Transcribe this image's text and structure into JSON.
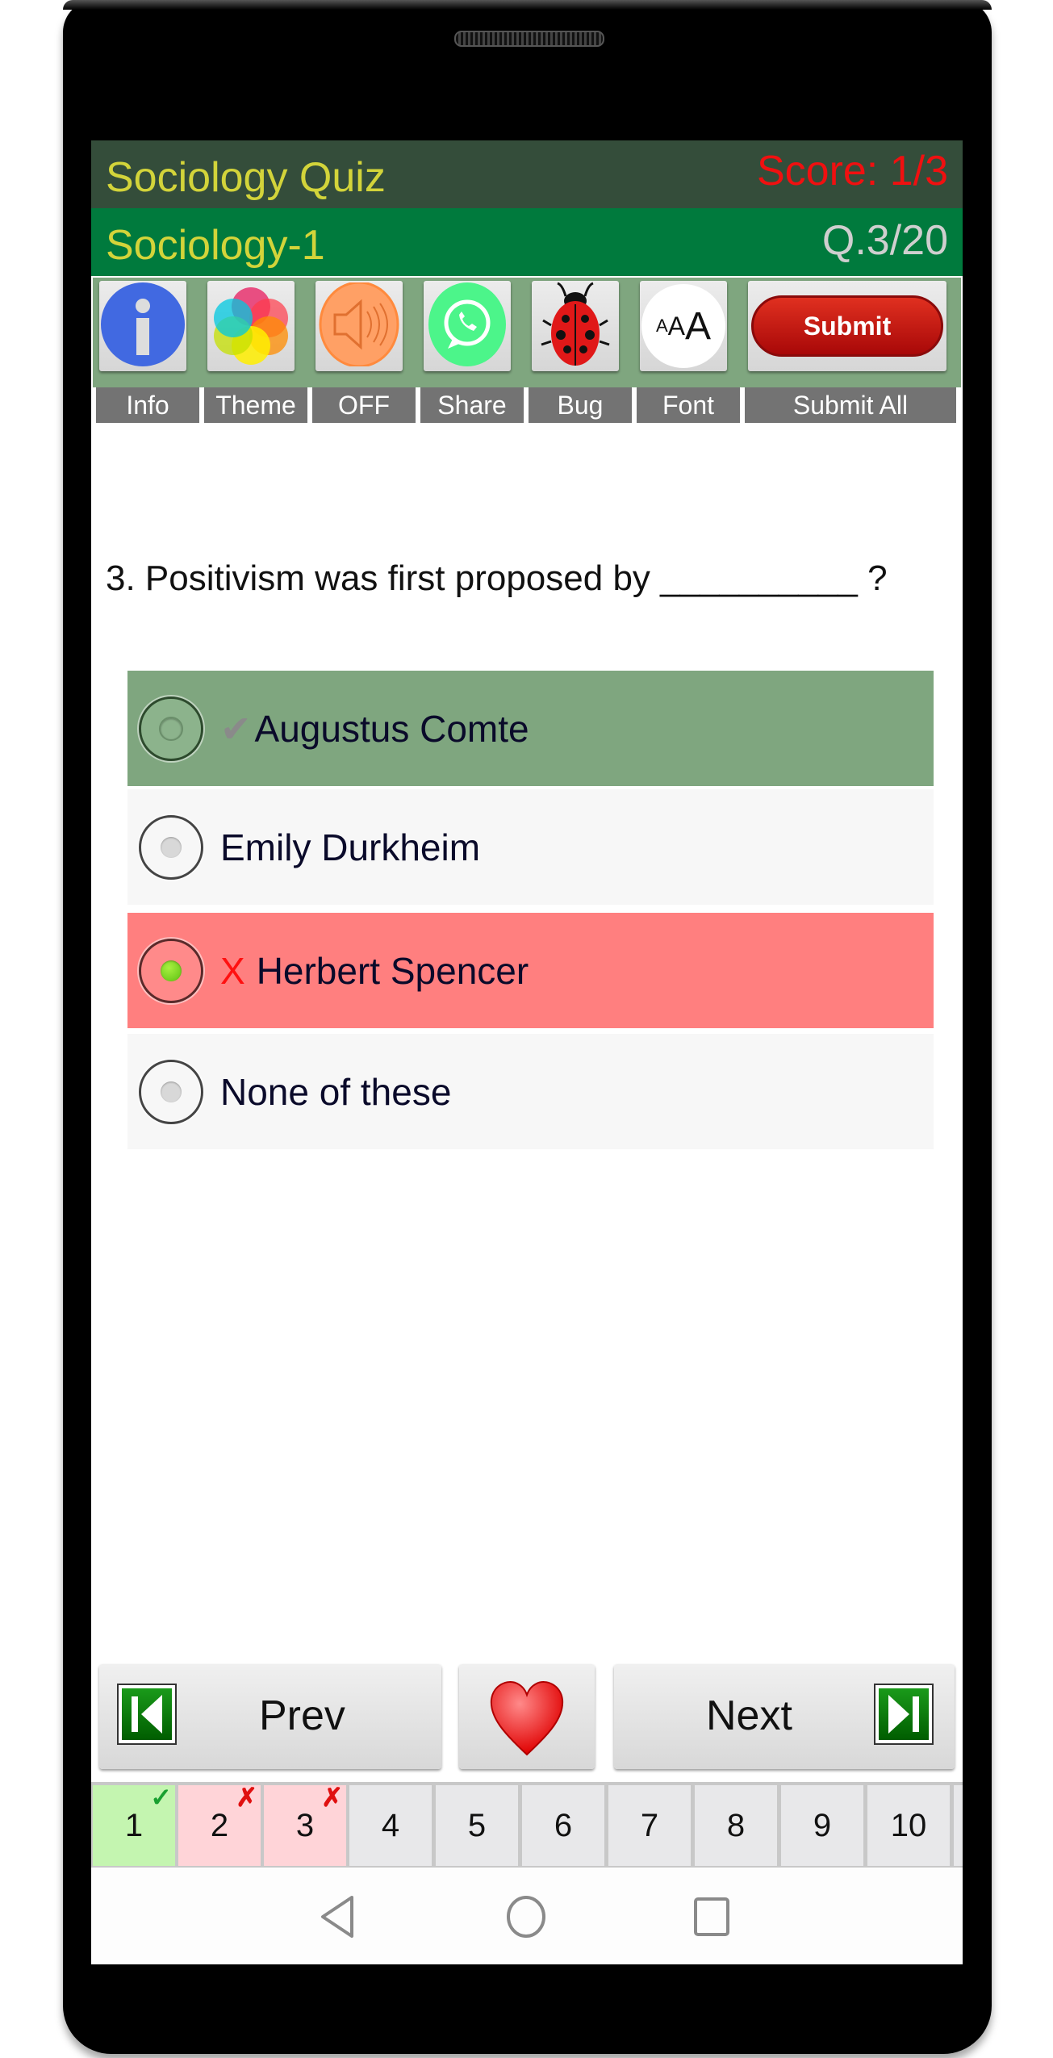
{
  "header": {
    "title": "Sociology Quiz",
    "score": "Score: 1/3"
  },
  "subheader": {
    "subject": "Sociology-1",
    "question_counter": "Q.3/20"
  },
  "toolbar": {
    "buttons": [
      {
        "icon": "info-icon",
        "label": "Info"
      },
      {
        "icon": "theme-icon",
        "label": "Theme"
      },
      {
        "icon": "speaker-icon",
        "label": "OFF"
      },
      {
        "icon": "whatsapp-icon",
        "label": "Share"
      },
      {
        "icon": "ladybug-icon",
        "label": "Bug"
      },
      {
        "icon": "font-size-icon",
        "label": "Font",
        "glyph": "AAA"
      },
      {
        "icon": "submit-icon",
        "label": "Submit All",
        "button_text": "Submit"
      }
    ]
  },
  "question": {
    "text": "3. Positivism was first proposed by __________ ?"
  },
  "options": [
    {
      "text": "Augustus Comte",
      "state": "correct",
      "marker": "✔",
      "selected": false,
      "color": "#7fa67f"
    },
    {
      "text": "Emily Durkheim",
      "state": "neutral",
      "marker": "",
      "selected": false,
      "color": "#f7f7f7"
    },
    {
      "text": "Herbert Spencer",
      "state": "wrong",
      "marker": "X",
      "selected": true,
      "color": "#ff7f7f"
    },
    {
      "text": "None of these",
      "state": "neutral",
      "marker": "",
      "selected": false,
      "color": "#f7f7f7"
    }
  ],
  "navigation": {
    "prev_label": "Prev",
    "next_label": "Next",
    "favorite_icon": "heart-icon"
  },
  "pages": [
    {
      "num": "1",
      "status": "correct",
      "badge": "✓"
    },
    {
      "num": "2",
      "status": "wrong",
      "badge": "✗"
    },
    {
      "num": "3",
      "status": "wrong",
      "badge": "✗"
    },
    {
      "num": "4",
      "status": "unanswered",
      "badge": ""
    },
    {
      "num": "5",
      "status": "unanswered",
      "badge": ""
    },
    {
      "num": "6",
      "status": "unanswered",
      "badge": ""
    },
    {
      "num": "7",
      "status": "unanswered",
      "badge": ""
    },
    {
      "num": "8",
      "status": "unanswered",
      "badge": ""
    },
    {
      "num": "9",
      "status": "unanswered",
      "badge": ""
    },
    {
      "num": "10",
      "status": "unanswered",
      "badge": ""
    }
  ],
  "colors": {
    "header_bg": "#344d3a",
    "subheader_bg": "#007a3d",
    "title_text": "#d3d43a",
    "score_text": "#f01010",
    "correct_bg": "#7fa67f",
    "wrong_bg": "#ff7f7f",
    "page_correct": "#c4f5b0",
    "page_wrong": "#ffd4d8"
  },
  "system_nav": [
    "back-icon",
    "home-icon",
    "recents-icon"
  ]
}
